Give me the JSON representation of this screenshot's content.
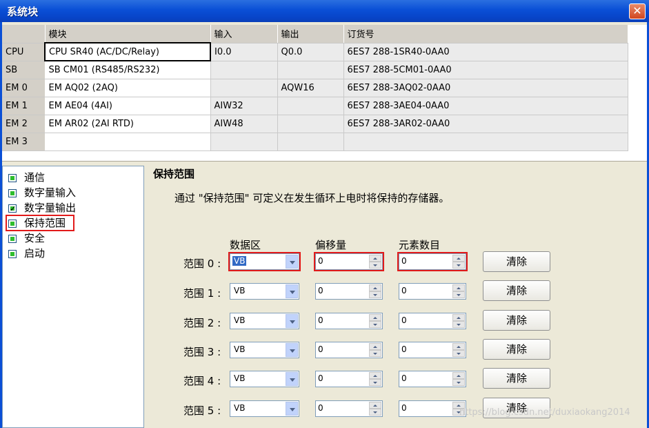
{
  "window": {
    "title": "系统块",
    "close_glyph": "✕"
  },
  "modules": {
    "columns": [
      "",
      "模块",
      "输入",
      "输出",
      "订货号"
    ],
    "rows": [
      {
        "slot": "CPU",
        "module": "CPU SR40 (AC/DC/Relay)",
        "input": "I0.0",
        "output": "Q0.0",
        "order": "6ES7 288-1SR40-0AA0"
      },
      {
        "slot": "SB",
        "module": "SB CM01 (RS485/RS232)",
        "input": "",
        "output": "",
        "order": "6ES7 288-5CM01-0AA0"
      },
      {
        "slot": "EM 0",
        "module": "EM AQ02 (2AQ)",
        "input": "",
        "output": "AQW16",
        "order": "6ES7 288-3AQ02-0AA0"
      },
      {
        "slot": "EM 1",
        "module": "EM AE04 (4AI)",
        "input": "AIW32",
        "output": "",
        "order": "6ES7 288-3AE04-0AA0"
      },
      {
        "slot": "EM 2",
        "module": "EM AR02 (2AI RTD)",
        "input": "AIW48",
        "output": "",
        "order": "6ES7 288-3AR02-0AA0"
      },
      {
        "slot": "EM 3",
        "module": "",
        "input": "",
        "output": "",
        "order": ""
      }
    ]
  },
  "tree": {
    "items": [
      {
        "label": "通信",
        "checked": false
      },
      {
        "label": "数字量输入",
        "checked": false
      },
      {
        "label": "数字量输出",
        "checked": true
      },
      {
        "label": "保持范围",
        "checked": false,
        "highlighted": true
      },
      {
        "label": "安全",
        "checked": false
      },
      {
        "label": "启动",
        "checked": false
      }
    ]
  },
  "retentive": {
    "title": "保持范围",
    "description": "通过 \"保持范围\" 可定义在发生循环上电时将保持的存储器。",
    "headers": {
      "area": "数据区",
      "offset": "偏移量",
      "count": "元素数目"
    },
    "clear_label": "清除",
    "ranges": [
      {
        "label": "范围 0 :",
        "area": "VB",
        "offset": "0",
        "count": "0"
      },
      {
        "label": "范围 1 :",
        "area": "VB",
        "offset": "0",
        "count": "0"
      },
      {
        "label": "范围 2 :",
        "area": "VB",
        "offset": "0",
        "count": "0"
      },
      {
        "label": "范围 3 :",
        "area": "VB",
        "offset": "0",
        "count": "0"
      },
      {
        "label": "范围 4 :",
        "area": "VB",
        "offset": "0",
        "count": "0"
      },
      {
        "label": "范围 5 :",
        "area": "VB",
        "offset": "0",
        "count": "0"
      }
    ]
  },
  "watermark": "https://blog.csdn.net/duxiaokang2014",
  "colors": {
    "accent": "#0a4fd6",
    "highlight": "#e21a1a",
    "selection": "#316ac5"
  }
}
